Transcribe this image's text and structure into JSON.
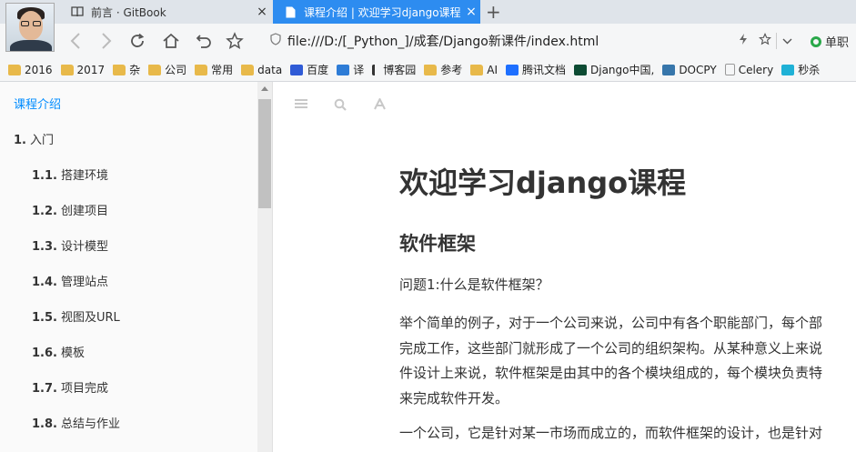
{
  "browser": {
    "tabs": [
      {
        "label": "前言 · GitBook",
        "close": "×"
      },
      {
        "label": "课程介绍 | 欢迎学习django课程",
        "close": "×"
      }
    ],
    "new_tab": "+",
    "address": "file:///D:/[_Python_]/成套/Django新课件/index.html",
    "search_engine": "单职",
    "bookmarks": [
      {
        "label": "2016",
        "icon": "folder-icon"
      },
      {
        "label": "2017",
        "icon": "folder-icon"
      },
      {
        "label": "杂",
        "icon": "folder-icon"
      },
      {
        "label": "公司",
        "icon": "folder-icon"
      },
      {
        "label": "常用",
        "icon": "folder-icon"
      },
      {
        "label": "data",
        "icon": "folder-icon"
      },
      {
        "label": "百度",
        "icon": "baidu-icon"
      },
      {
        "label": "译",
        "icon": "translate-icon"
      },
      {
        "label": "博客园",
        "icon": "cnblogs-icon"
      },
      {
        "label": "参考",
        "icon": "folder-icon"
      },
      {
        "label": "AI",
        "icon": "folder-icon"
      },
      {
        "label": "腾讯文档",
        "icon": "tencent-docs-icon"
      },
      {
        "label": "Django中国,",
        "icon": "django-icon"
      },
      {
        "label": "DOCPY",
        "icon": "python-icon"
      },
      {
        "label": "Celery",
        "icon": "page-icon"
      },
      {
        "label": "秒杀",
        "icon": "seckill-icon"
      }
    ]
  },
  "sidebar": {
    "items": [
      {
        "num": "",
        "label": "课程介绍"
      },
      {
        "num": "1.",
        "label": "入门"
      },
      {
        "num": "1.1.",
        "label": "搭建环境"
      },
      {
        "num": "1.2.",
        "label": "创建项目"
      },
      {
        "num": "1.3.",
        "label": "设计模型"
      },
      {
        "num": "1.4.",
        "label": "管理站点"
      },
      {
        "num": "1.5.",
        "label": "视图及URL"
      },
      {
        "num": "1.6.",
        "label": "模板"
      },
      {
        "num": "1.7.",
        "label": "项目完成"
      },
      {
        "num": "1.8.",
        "label": "总结与作业"
      }
    ]
  },
  "content": {
    "title": "欢迎学习django课程",
    "subtitle": "软件框架",
    "paragraphs": [
      "问题1:什么是软件框架？",
      "举个简单的例子，对于一个公司来说，公司中有各个职能部门，每个部",
      "完成工作，这些部门就形成了一个公司的组织架构。从某种意义上来说",
      "件设计上来说，软件框架是由其中的各个模块组成的，每个模块负责特",
      "来完成软件开发。",
      "一个公司，它是针对某一市场而成立的，而软件框架的设计，也是针对"
    ]
  },
  "colors": {
    "accent": "#2d8cf0",
    "active_link": "#008cff"
  }
}
